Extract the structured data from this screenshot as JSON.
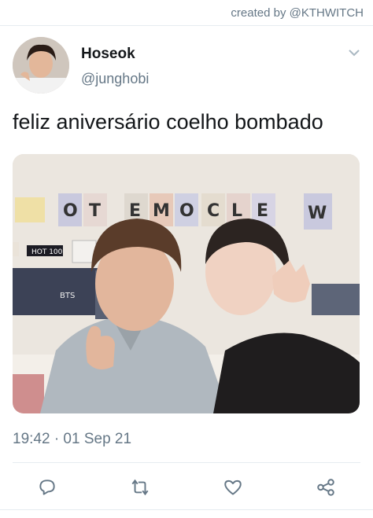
{
  "credit": "created by @KTHWITCH",
  "user": {
    "name": "Hoseok",
    "handle": "@junghobi"
  },
  "tweet": {
    "text": "feliz aniversário coelho bombado",
    "timestamp": "19:42 · 01 Sep 21"
  },
  "photo": {
    "banner_letters": [
      "O",
      "T",
      "E",
      "M",
      "O",
      "C",
      "L",
      "E",
      "W"
    ],
    "sign_text": "HOT 100",
    "poster_text": "BTS"
  },
  "actions": [
    "reply-icon",
    "retweet-icon",
    "like-icon",
    "share-icon"
  ],
  "colors": {
    "secondary": "#657786",
    "icon": "#657786",
    "text": "#14171a"
  }
}
